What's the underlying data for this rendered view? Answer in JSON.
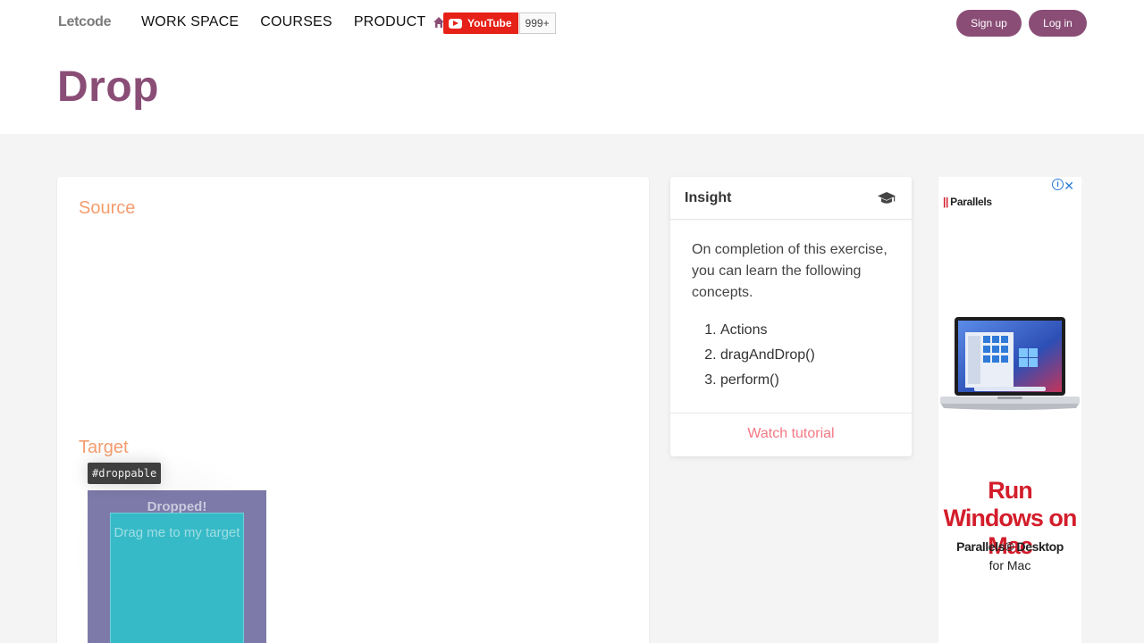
{
  "header": {
    "logo": "Letcode",
    "nav": [
      "WORK SPACE",
      "COURSES",
      "PRODUCT"
    ],
    "youtube": {
      "label": "YouTube",
      "count": "999+"
    },
    "signup_label": "Sign up",
    "login_label": "Log in",
    "page_title": "Drop"
  },
  "main": {
    "source_label": "Source",
    "target_label": "Target",
    "tooltip": "#droppable",
    "droppable_text": "Dropped!",
    "draggable_text": "Drag me to my target"
  },
  "insight": {
    "title": "Insight",
    "intro": "On completion of this exercise, you can learn the following concepts.",
    "concepts": [
      "Actions",
      "dragAndDrop()",
      "perform()"
    ],
    "watch_label": "Watch tutorial"
  },
  "ad": {
    "brand": "Parallels",
    "headline": "Run Windows on Mac",
    "product": "Parallels® Desktop",
    "sub": "for Mac"
  },
  "colors": {
    "brand": "#8a4d76",
    "section_label": "#f49d6e",
    "droppable_bg": "#7d7aa9",
    "draggable_bg": "#37bac7",
    "link": "#f47884",
    "ad_red": "#d31d2b"
  }
}
